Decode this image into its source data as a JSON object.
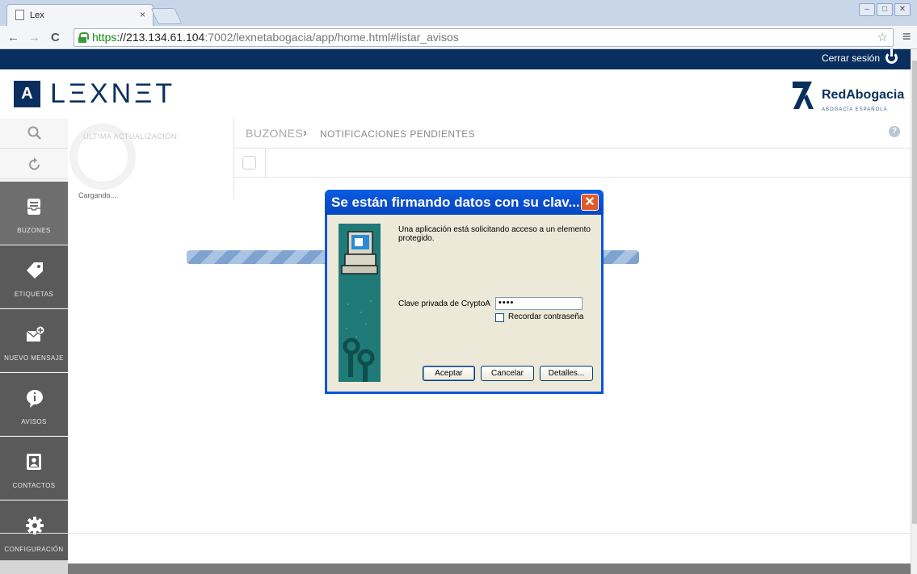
{
  "browser": {
    "tab_title": "Lex",
    "tab_close": "×",
    "url_scheme": "https",
    "url_host": "://213.134.61.104",
    "url_rest": ":7002/lexnetabogacia/app/home.html#listar_avisos",
    "window_buttons": [
      "–",
      "□",
      "✕"
    ]
  },
  "header": {
    "logout_label": "Cerrar sesión",
    "logo_mark": "A",
    "logo_text": "LΞXNΞT",
    "partner_name": "RedAbogacia",
    "partner_sub": "ABOGACÍA ESPAÑOLA"
  },
  "sidebar": {
    "items": [
      {
        "label": "BUZONES",
        "icon": "inbox-icon"
      },
      {
        "label": "ETIQUETAS",
        "icon": "tag-icon"
      },
      {
        "label": "NUEVO MENSAJE",
        "icon": "new-message-icon"
      },
      {
        "label": "AVISOS",
        "icon": "alert-icon"
      },
      {
        "label": "CONTACTOS",
        "icon": "contacts-icon"
      },
      {
        "label": "CONFIGURACIÓN",
        "icon": "settings-icon"
      }
    ]
  },
  "content": {
    "last_update_label": "ÚLTIMA ACTUALIZACIÓN:",
    "loading_text": "Cargando...",
    "breadcrumb_root": "BUZONES",
    "breadcrumb_sep": "›",
    "breadcrumb_current": "NOTIFICACIONES PENDIENTES",
    "help": "?"
  },
  "dialog": {
    "title": "Se están firmando datos con su clav...",
    "message": "Una aplicación está solicitando acceso a un elemento protegido.",
    "password_label": "Clave privada de CryptoA",
    "password_value": "••••",
    "remember_label": "Recordar contraseña",
    "remember_checked": false,
    "buttons": {
      "accept": "Aceptar",
      "cancel": "Cancelar",
      "details": "Detalles..."
    }
  },
  "colors": {
    "brand_navy": "#0a2f5e",
    "xp_titlebar": "#0a55d9",
    "sidebar_dark": "#5a5a5a"
  }
}
